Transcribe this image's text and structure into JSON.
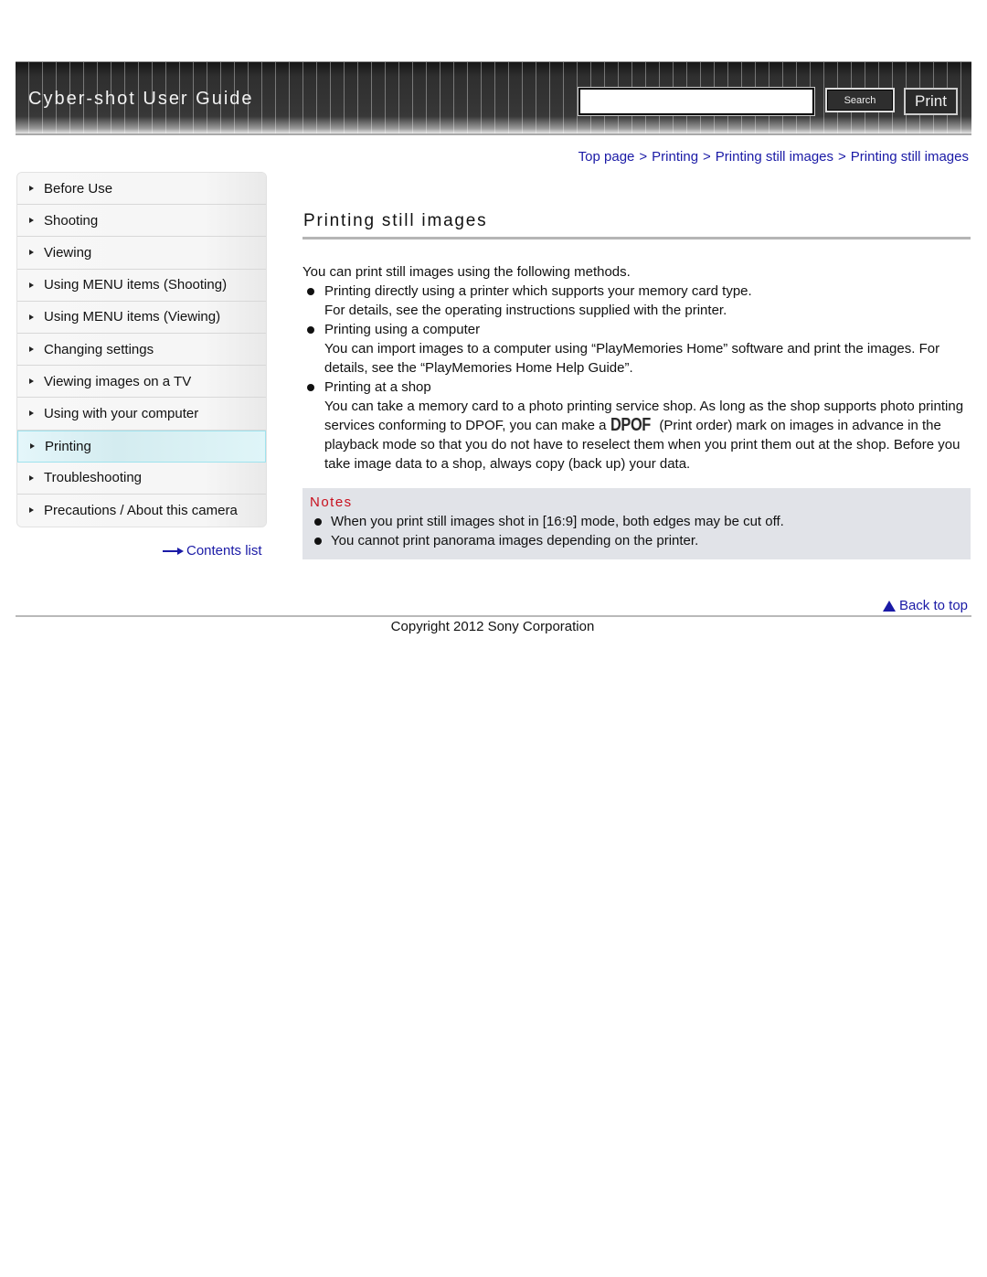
{
  "header": {
    "title": "Cyber-shot User Guide",
    "search": {
      "value": "",
      "placeholder": ""
    },
    "search_label": "Search",
    "print_label": "Print"
  },
  "breadcrumb": {
    "items": [
      "Top page",
      "Printing",
      "Printing still images",
      "Printing still images"
    ],
    "separator": ">"
  },
  "sidebar": {
    "items": [
      {
        "label": "Before Use",
        "active": false
      },
      {
        "label": "Shooting",
        "active": false
      },
      {
        "label": "Viewing",
        "active": false
      },
      {
        "label": "Using MENU items (Shooting)",
        "active": false
      },
      {
        "label": "Using MENU items (Viewing)",
        "active": false
      },
      {
        "label": "Changing settings",
        "active": false
      },
      {
        "label": "Viewing images on a TV",
        "active": false
      },
      {
        "label": "Using with your computer",
        "active": false
      },
      {
        "label": "Printing",
        "active": true
      },
      {
        "label": "Troubleshooting",
        "active": false
      },
      {
        "label": "Precautions / About this camera",
        "active": false
      }
    ],
    "contents_link": "Contents list"
  },
  "main": {
    "title": "Printing still images",
    "intro": "You can print still images using the following methods.",
    "methods": [
      {
        "label": "Printing directly using a printer which supports your memory card type.",
        "detail": "For details, see the operating instructions supplied with the printer."
      },
      {
        "label": "Printing using a computer",
        "detail": "You can import images to a computer using “PlayMemories Home” software and print the images. For details, see the “PlayMemories Home Help Guide”."
      },
      {
        "label": "Printing at a shop",
        "detail_before": "You can take a memory card to a photo printing service shop. As long as the shop supports photo printing services conforming to DPOF, you can make a ",
        "dpof_mark": "DPOF",
        "detail_after": " (Print order) mark on images in advance in the playback mode so that you do not have to reselect them when you print them out at the shop. Before you take image data to a shop, always copy (back up) your data."
      }
    ],
    "notes": {
      "title": "Notes",
      "items": [
        "When you print still images shot in [16:9] mode, both edges may be cut off.",
        "You cannot print panorama images depending on the printer."
      ]
    }
  },
  "footer": {
    "back_to_top": "Back to top",
    "copyright": "Copyright 2012 Sony Corporation"
  },
  "colors": {
    "link": "#1a1aa6",
    "notes_title": "#c8101e",
    "notes_bg": "#e1e3e8",
    "active_nav": "#d4ecf0"
  }
}
